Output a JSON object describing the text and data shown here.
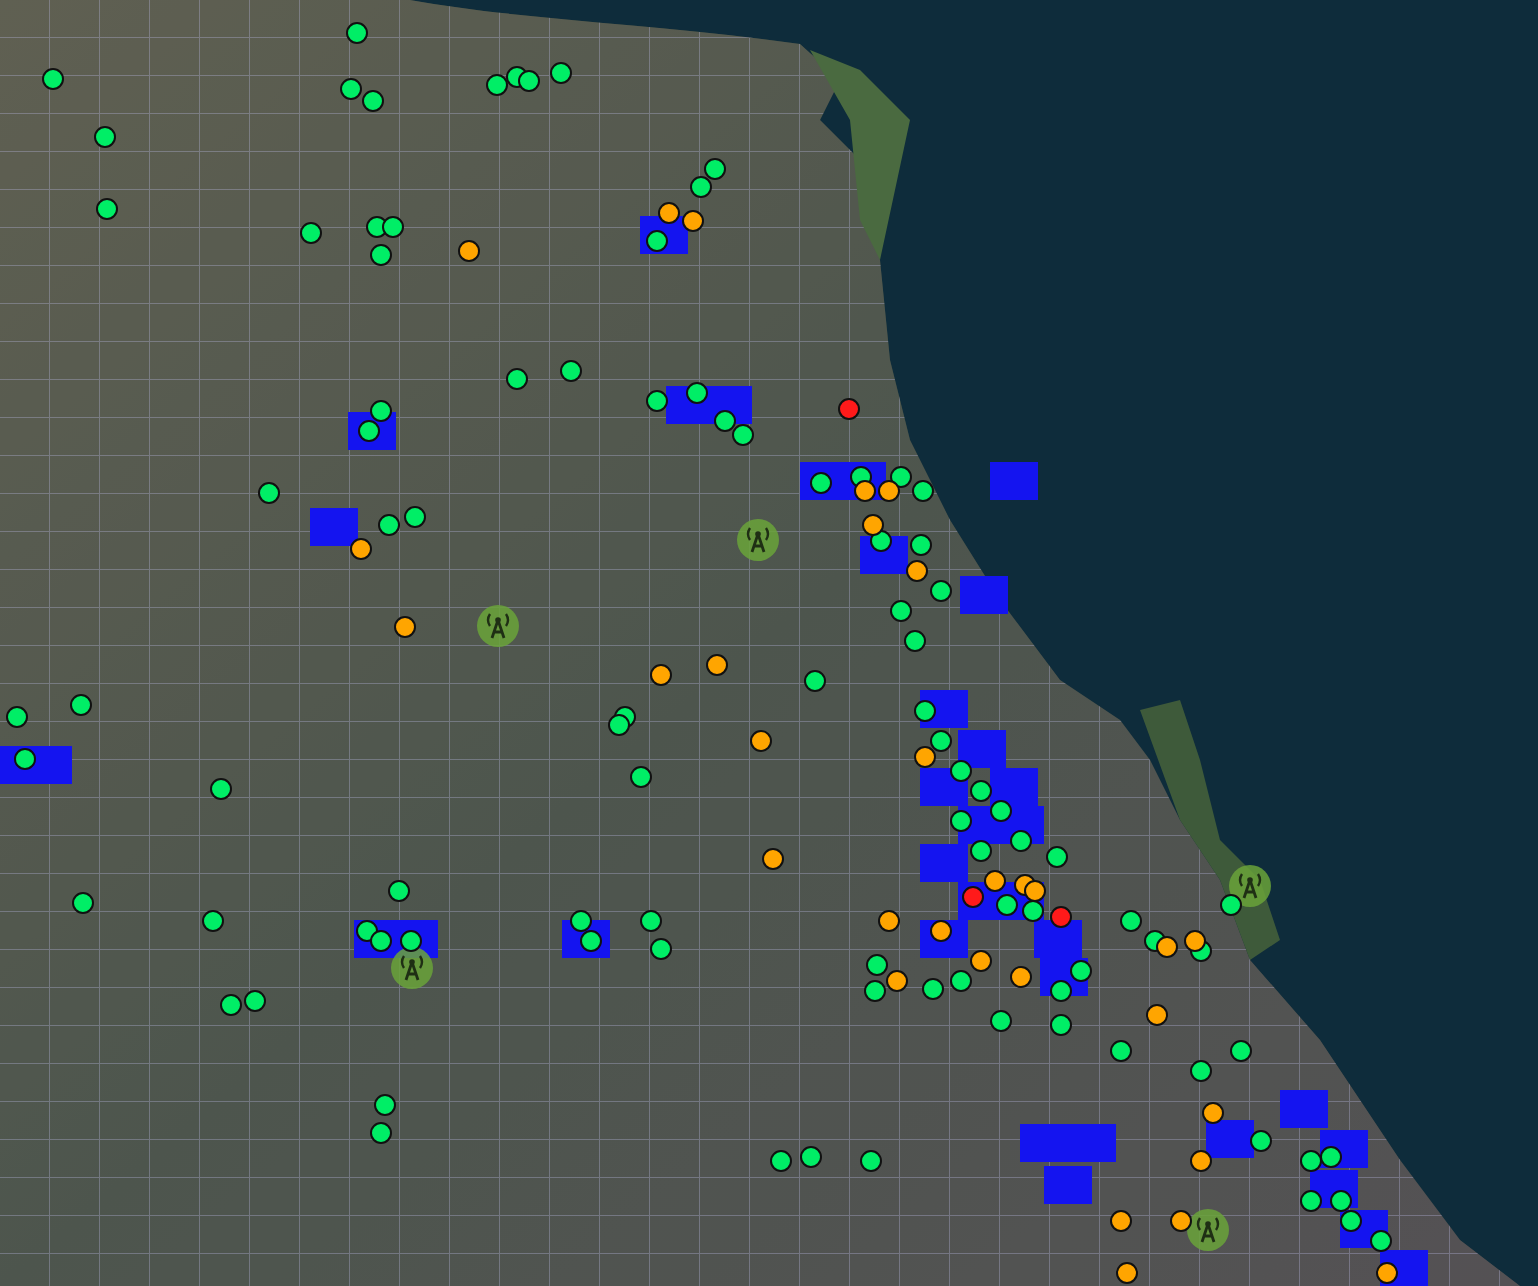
{
  "map": {
    "markers": [
      {
        "color": "#00ee66"
      },
      {
        "color": "#00ee66"
      },
      {
        "color": "#00ee66"
      },
      {
        "color": "#00ee66"
      },
      {
        "color": "#00ee66"
      },
      {
        "color": "#00ee66"
      },
      {
        "color": "#00ee66"
      },
      {
        "color": "#00ee66"
      },
      {
        "color": "#00ee66"
      },
      {
        "color": "#00ee66"
      },
      {
        "color": "#00ee66"
      },
      {
        "color": "#00ee66"
      },
      {
        "color": "#00ee66"
      },
      {
        "color": "#00ee66"
      },
      {
        "color": "#00ee66"
      },
      {
        "color": "#00ee66"
      },
      {
        "color": "#00ee66"
      },
      {
        "color": "#00ee66"
      },
      {
        "color": "#00ee66"
      },
      {
        "color": "#00ee66"
      },
      {
        "color": "#00ee66"
      },
      {
        "color": "#00ee66"
      },
      {
        "color": "#00ee66"
      },
      {
        "color": "#00ee66"
      },
      {
        "color": "#00ee66"
      },
      {
        "color": "#00ee66"
      },
      {
        "color": "#00ee66"
      },
      {
        "color": "#00ee66"
      },
      {
        "color": "#00ee66"
      },
      {
        "color": "#00ee66"
      },
      {
        "color": "#00ee66"
      },
      {
        "color": "#00ee66"
      },
      {
        "color": "#00ee66"
      },
      {
        "color": "#00ee66"
      },
      {
        "color": "#00ee66"
      },
      {
        "color": "#00ee66"
      },
      {
        "color": "#00ee66"
      },
      {
        "color": "#00ee66"
      },
      {
        "color": "#00ee66"
      },
      {
        "color": "#00ee66"
      },
      {
        "color": "#00ee66"
      },
      {
        "color": "#00ee66"
      },
      {
        "color": "#00ee66"
      },
      {
        "color": "#00ee66"
      },
      {
        "color": "#00ee66"
      },
      {
        "color": "#00ee66"
      },
      {
        "color": "#00ee66"
      },
      {
        "color": "#00ee66"
      },
      {
        "color": "#00ee66"
      },
      {
        "color": "#00ee66"
      },
      {
        "color": "#00ee66"
      },
      {
        "color": "#00ee66"
      },
      {
        "color": "#00ee66"
      },
      {
        "color": "#00ee66"
      },
      {
        "color": "#00ee66"
      },
      {
        "color": "#00ee66"
      },
      {
        "color": "#00ee66"
      },
      {
        "color": "#00ee66"
      },
      {
        "color": "#00ee66"
      },
      {
        "color": "#00ee66"
      },
      {
        "color": "#00ee66"
      },
      {
        "color": "#00ee66"
      },
      {
        "color": "#00ee66"
      },
      {
        "color": "#00ee66"
      },
      {
        "color": "#00ee66"
      },
      {
        "color": "#00ee66"
      },
      {
        "color": "#00ee66"
      },
      {
        "color": "#00ee66"
      },
      {
        "color": "#00ee66"
      },
      {
        "color": "#00ee66"
      },
      {
        "color": "#00ee66"
      },
      {
        "color": "#00ee66"
      },
      {
        "color": "#00ee66"
      },
      {
        "color": "#00ee66"
      },
      {
        "color": "#00ee66"
      },
      {
        "color": "#00ee66"
      },
      {
        "color": "#00ee66"
      },
      {
        "color": "#00ee66"
      },
      {
        "color": "#00ee66"
      },
      {
        "color": "#00ee66"
      },
      {
        "color": "#00ee66"
      },
      {
        "color": "#00ee66"
      },
      {
        "color": "#00ee66"
      },
      {
        "color": "#00ee66"
      },
      {
        "color": "#00ee66"
      },
      {
        "color": "#00ee66"
      },
      {
        "color": "#00ee66"
      },
      {
        "color": "#00ee66"
      },
      {
        "color": "#00ee66"
      },
      {
        "color": "#00ee66"
      },
      {
        "color": "#00ee66"
      },
      {
        "color": "#00ee66"
      },
      {
        "color": "#00ee66"
      },
      {
        "color": "#00ee66"
      },
      {
        "color": "#00ee66"
      },
      {
        "color": "#ffa500"
      },
      {
        "color": "#ffa500"
      },
      {
        "color": "#ffa500"
      },
      {
        "color": "#ffa500"
      },
      {
        "color": "#ffa500"
      },
      {
        "color": "#ffa500"
      },
      {
        "color": "#ffa500"
      },
      {
        "color": "#ffa500"
      },
      {
        "color": "#ffa500"
      },
      {
        "color": "#ffa500"
      },
      {
        "color": "#ffa500"
      },
      {
        "color": "#ffa500"
      },
      {
        "color": "#ffa500"
      },
      {
        "color": "#ffa500"
      },
      {
        "color": "#ffa500"
      },
      {
        "color": "#ffa500"
      },
      {
        "color": "#ffa500"
      },
      {
        "color": "#ffa500"
      },
      {
        "color": "#ffa500"
      },
      {
        "color": "#ffa500"
      },
      {
        "color": "#ffa500"
      },
      {
        "color": "#ffa500"
      },
      {
        "color": "#ffa500"
      },
      {
        "color": "#ffa500"
      },
      {
        "color": "#ffa500"
      },
      {
        "color": "#ffa500"
      },
      {
        "color": "#ffa500"
      },
      {
        "color": "#ffa500"
      },
      {
        "color": "#ffa500"
      },
      {
        "color": "#ffa500"
      },
      {
        "color": "#ffa500"
      },
      {
        "color": "#ff1a1a"
      },
      {
        "color": "#ff1a1a"
      },
      {
        "color": "#ff1a1a"
      }
    ],
    "coverage_cells": [
      {
        "color": "#1414f0"
      },
      {
        "color": "#1414f0"
      },
      {
        "color": "#1414f0"
      },
      {
        "color": "#1414f0"
      },
      {
        "color": "#1414f0"
      },
      {
        "color": "#1414f0"
      },
      {
        "color": "#1414f0"
      },
      {
        "color": "#1414f0"
      },
      {
        "color": "#1414f0"
      },
      {
        "color": "#1414f0"
      },
      {
        "color": "#1414f0"
      },
      {
        "color": "#1414f0"
      },
      {
        "color": "#1414f0"
      },
      {
        "color": "#1414f0"
      },
      {
        "color": "#1414f0"
      },
      {
        "color": "#1414f0"
      },
      {
        "color": "#1414f0"
      },
      {
        "color": "#1414f0"
      },
      {
        "color": "#1414f0"
      },
      {
        "color": "#1414f0"
      },
      {
        "color": "#1414f0"
      },
      {
        "color": "#1414f0"
      },
      {
        "color": "#1414f0"
      },
      {
        "color": "#1414f0"
      },
      {
        "color": "#1414f0"
      },
      {
        "color": "#1414f0"
      },
      {
        "color": "#1414f0"
      },
      {
        "color": "#1414f0"
      },
      {
        "color": "#1414f0"
      },
      {
        "color": "#1414f0"
      },
      {
        "color": "#1414f0"
      },
      {
        "color": "#1414f0"
      },
      {
        "color": "#1414f0"
      },
      {
        "color": "#1414f0"
      },
      {
        "color": "#1414f0"
      },
      {
        "color": "#1414f0"
      }
    ]
  }
}
